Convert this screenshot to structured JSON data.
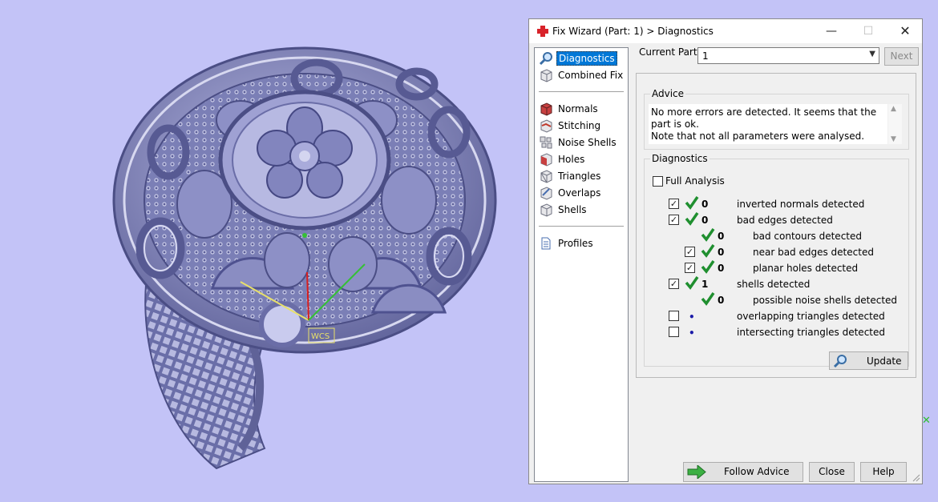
{
  "viewport": {
    "background": "#c3c3f7",
    "model_color": "#7b7fb6",
    "gizmo_label": "WCS"
  },
  "dialog": {
    "title": "Fix Wizard (Part: 1) > Diagnostics",
    "window_buttons": {
      "minimize": "—",
      "maximize": "☐",
      "close": "✕"
    },
    "nav": {
      "items": [
        {
          "label": "Diagnostics",
          "icon": "magnifier-icon",
          "active": true
        },
        {
          "label": "Combined Fix",
          "icon": "cube-icon"
        },
        {
          "label": "Normals",
          "icon": "normals-icon"
        },
        {
          "label": "Stitching",
          "icon": "stitching-icon"
        },
        {
          "label": "Noise Shells",
          "icon": "noise-shells-icon"
        },
        {
          "label": "Holes",
          "icon": "holes-icon"
        },
        {
          "label": "Triangles",
          "icon": "triangles-icon"
        },
        {
          "label": "Overlaps",
          "icon": "overlaps-icon"
        },
        {
          "label": "Shells",
          "icon": "shells-icon"
        },
        {
          "label": "Profiles",
          "icon": "document-icon"
        }
      ]
    },
    "current_part": {
      "label": "Current Part:",
      "value": "1",
      "next_label": "Next"
    },
    "advice": {
      "title": "Advice",
      "text_line1": "No more errors are detected. It seems that the part is ok.",
      "text_line2": "Note that not all parameters were analysed."
    },
    "diagnostics": {
      "title": "Diagnostics",
      "full_analysis_label": "Full Analysis",
      "full_analysis_checked": false,
      "rows": [
        {
          "checked": true,
          "status": "ok",
          "count": "0",
          "label": "inverted normals detected"
        },
        {
          "checked": true,
          "status": "ok",
          "count": "0",
          "label": "bad edges detected"
        },
        {
          "checked": null,
          "status": "ok",
          "count": "0",
          "label": "bad contours detected"
        },
        {
          "checked": true,
          "status": "ok",
          "count": "0",
          "label": "near bad edges detected"
        },
        {
          "checked": true,
          "status": "ok",
          "count": "0",
          "label": "planar holes detected"
        },
        {
          "checked": true,
          "status": "ok",
          "count": "1",
          "label": "shells detected"
        },
        {
          "checked": null,
          "status": "ok",
          "count": "0",
          "label": "possible noise shells detected"
        },
        {
          "checked": false,
          "status": "not-run",
          "count": "",
          "label": "overlapping triangles detected"
        },
        {
          "checked": false,
          "status": "not-run",
          "count": "",
          "label": "intersecting triangles detected"
        }
      ],
      "update_label": "Update"
    },
    "buttons": {
      "follow_advice": "Follow Advice",
      "close": "Close",
      "help": "Help"
    },
    "colors": {
      "selection": "#0078d7",
      "ok_check": "#1f8f2f"
    }
  }
}
